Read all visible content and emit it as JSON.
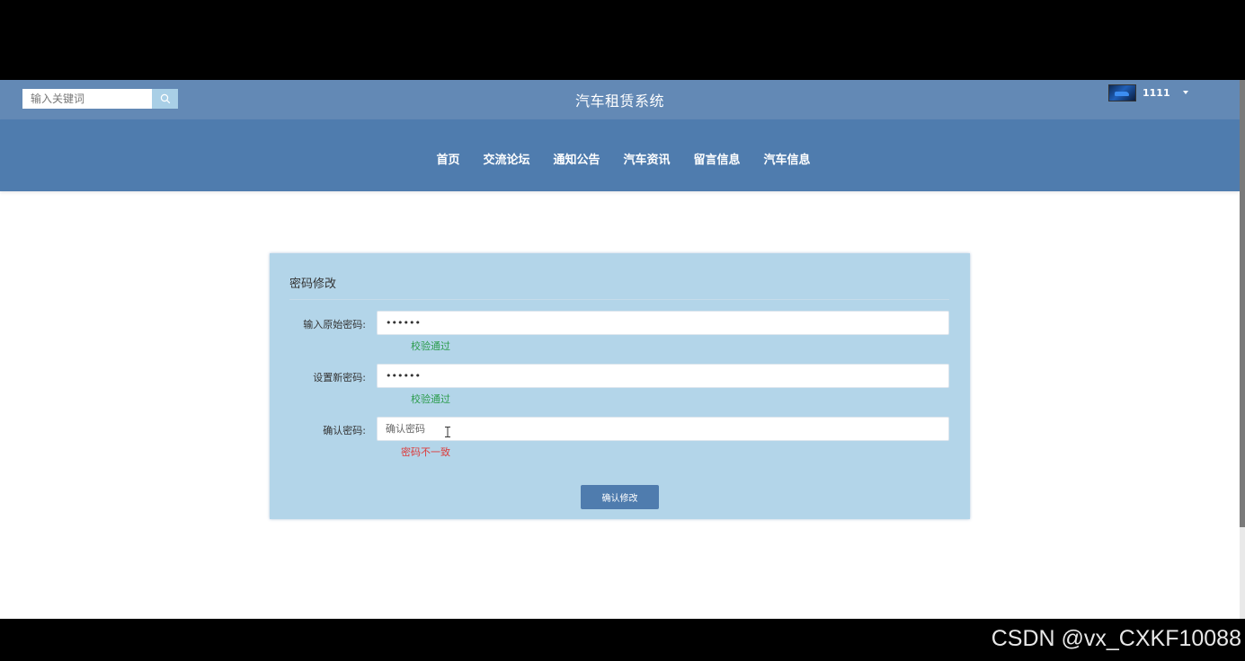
{
  "header": {
    "search_placeholder": "输入关键词",
    "site_title": "汽车租赁系统",
    "username": "1111"
  },
  "nav": {
    "items": [
      {
        "label": "首页"
      },
      {
        "label": "交流论坛"
      },
      {
        "label": "通知公告"
      },
      {
        "label": "汽车资讯"
      },
      {
        "label": "留言信息"
      },
      {
        "label": "汽车信息"
      }
    ]
  },
  "form": {
    "title": "密码修改",
    "old_password": {
      "label": "输入原始密码:",
      "value": "••••••",
      "hint": "校验通过"
    },
    "new_password": {
      "label": "设置新密码:",
      "value": "••••••",
      "hint": "校验通过"
    },
    "confirm_password": {
      "label": "确认密码:",
      "placeholder": "确认密码",
      "hint": "密码不一致"
    },
    "submit_label": "确认修改"
  },
  "colors": {
    "topbar": "#6389b5",
    "navbar": "#4f7cae",
    "panel": "#b3d5e9",
    "success": "#2c9c4d",
    "error": "#dc3b3b"
  },
  "watermark": "CSDN @vx_CXKF10088"
}
